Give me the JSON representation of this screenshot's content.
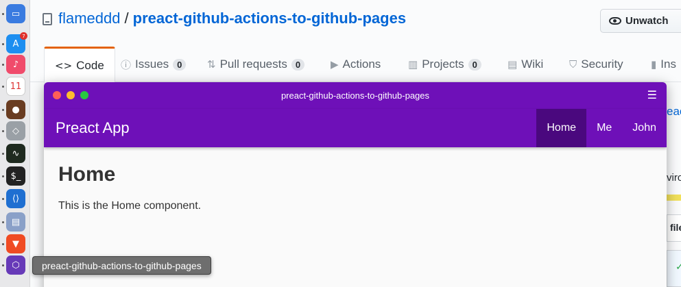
{
  "dock": {
    "apps": [
      {
        "name": "keynote",
        "glyph": "▭",
        "color": "#3a7be0"
      },
      {
        "name": "app-store",
        "glyph": "A",
        "color": "#1d8ef0",
        "badge": "7"
      },
      {
        "name": "music",
        "glyph": "♪",
        "color": "#f04b6b"
      },
      {
        "name": "calendar",
        "glyph": "11",
        "color": "#ffffff"
      },
      {
        "name": "postico",
        "glyph": "●",
        "color": "#6a3d22"
      },
      {
        "name": "xcode-like",
        "glyph": "◇",
        "color": "#9aa0a6"
      },
      {
        "name": "activity-monitor",
        "glyph": "∿",
        "color": "#1f2a1f"
      },
      {
        "name": "terminal",
        "glyph": "$_",
        "color": "#222222"
      },
      {
        "name": "vscode",
        "glyph": "⟨⟩",
        "color": "#1f6fd1"
      },
      {
        "name": "preview",
        "glyph": "▤",
        "color": "#8aa0c8"
      },
      {
        "name": "brave",
        "glyph": "▼",
        "color": "#f04b23"
      },
      {
        "name": "preact-app",
        "glyph": "⬡",
        "color": "#673ab8"
      }
    ]
  },
  "repo": {
    "owner": "flameddd",
    "separator": "/",
    "name": "preact-github-actions-to-github-pages",
    "watch_label": "Unwatch"
  },
  "tabs": [
    {
      "label": "Code",
      "icon": "code-icon",
      "glyph": "<>"
    },
    {
      "label": "Issues",
      "icon": "issue-icon",
      "glyph": "ⓘ",
      "count": "0"
    },
    {
      "label": "Pull requests",
      "icon": "pull-request-icon",
      "glyph": "⇅",
      "count": "0"
    },
    {
      "label": "Actions",
      "icon": "play-icon",
      "glyph": "▶"
    },
    {
      "label": "Projects",
      "icon": "project-icon",
      "glyph": "▥",
      "count": "0"
    },
    {
      "label": "Wiki",
      "icon": "book-icon",
      "glyph": "▤"
    },
    {
      "label": "Security",
      "icon": "shield-icon",
      "glyph": "⛉"
    },
    {
      "label": "Ins",
      "icon": "graph-icon",
      "glyph": "▮"
    }
  ],
  "gh_side": {
    "link_fragment": "eac",
    "env_fragment": "viro",
    "files_fragment": "file",
    "check_glyph": "✓"
  },
  "app_window": {
    "title": "preact-github-actions-to-github-pages",
    "menu_glyph": "☰",
    "brand": "Preact App",
    "nav": [
      {
        "label": "Home",
        "active": true
      },
      {
        "label": "Me",
        "active": false
      },
      {
        "label": "John",
        "active": false
      }
    ],
    "heading": "Home",
    "body": "This is the Home component."
  },
  "tooltip": "preact-github-actions-to-github-pages",
  "colors": {
    "brand_purple": "#6e10b8",
    "active_nav": "#4a087e",
    "github_link": "#0366d6",
    "tab_underline": "#e36209"
  }
}
